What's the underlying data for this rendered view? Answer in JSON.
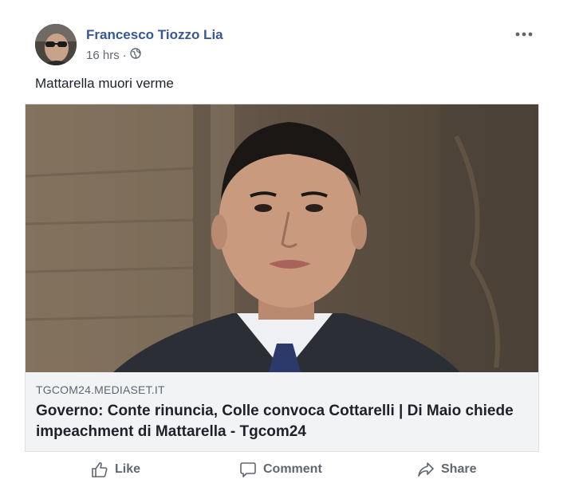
{
  "post": {
    "author": "Francesco Tiozzo Lia",
    "time": "16 hrs",
    "separator": "·",
    "privacy_icon": "globe-icon",
    "more_icon": "more-options-icon",
    "text": "Mattarella muori verme"
  },
  "link": {
    "domain": "TGCOM24.MEDIASET.IT",
    "title": "Governo: Conte rinuncia, Colle convoca Cottarelli | Di Maio chiede impeachment di Mattarella - Tgcom24"
  },
  "actions": {
    "like_label": "Like",
    "comment_label": "Comment",
    "share_label": "Share"
  },
  "colors": {
    "author_link": "#365899",
    "meta_text": "#606770",
    "card_background": "#f2f3f5"
  }
}
